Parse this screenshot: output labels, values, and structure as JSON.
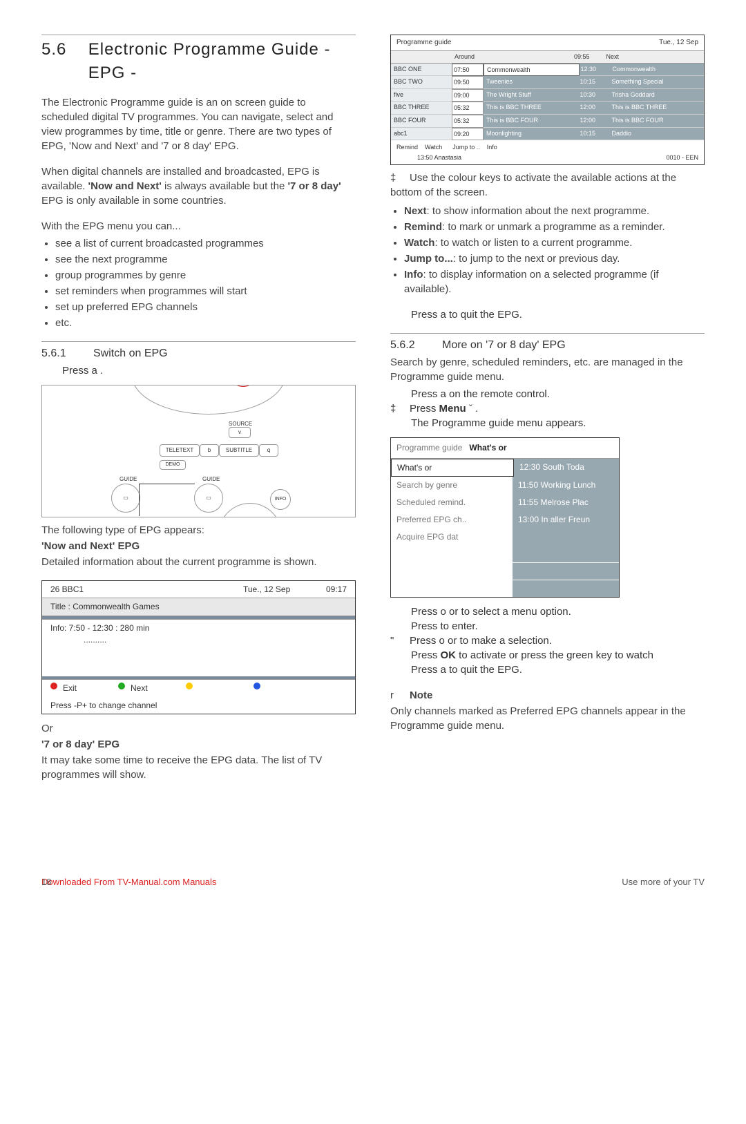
{
  "section": {
    "number": "5.6",
    "title": "Electronic Programme Guide - EPG -"
  },
  "intro": {
    "p1": "The Electronic Programme guide is an on screen guide to scheduled digital TV programmes. You can navigate, select and view programmes by time, title or genre. There are two types of EPG, 'Now and Next' and '7 or 8 day' EPG.",
    "p2a": "When digital channels are installed and broadcasted, EPG is available. ",
    "p2b": "'Now and Next'",
    "p2c": " is always available but the ",
    "p2d": "'7 or 8 day'",
    "p2e": " EPG is only available in some countries.",
    "p3": "With the EPG menu you can...",
    "bullets": [
      "see a list of current broadcasted programmes",
      "see the next programme",
      "group programmes by genre",
      "set reminders when programmes will start",
      "set up preferred EPG channels",
      "etc."
    ]
  },
  "s561": {
    "num": "5.6.1",
    "title": "Switch on EPG",
    "step1": "Press a   .",
    "after_remote": "The following type of EPG appears:",
    "now_next_hdr": "'Now and Next' EPG",
    "now_next_txt": "Detailed information about the current programme is shown.",
    "or": "Or",
    "seven_hdr": "'7 or 8 day' EPG",
    "seven_txt": "It may take some time to receive the EPG data. The list of TV programmes will show."
  },
  "remote": {
    "source": "SOURCE",
    "v": "v",
    "teletext": "TELETEXT",
    "b": "b",
    "subtitle": "SUBTITLE",
    "q": "q",
    "demo": "DEMO",
    "guide": "GUIDE",
    "info": "INFO"
  },
  "nownext": {
    "ch": "26   BBC1",
    "date": "Tue., 12 Sep",
    "time": "09:17",
    "title": "Title : Commonwealth Games",
    "info": "Info: 7:50 - 12:30 : 280 min",
    "dots": "..........",
    "exit": "Exit",
    "next": "Next",
    "press": "Press -P+ to change channel"
  },
  "grid": {
    "title": "Programme guide",
    "date": "Tue., 12 Sep",
    "around": "Around",
    "aroundTime": "09:55",
    "next": "Next",
    "rows": [
      {
        "ch": "BBC ONE",
        "t1": "07:50",
        "p1": "Commonwealth",
        "t2": "12:30",
        "p2": "Commonwealth"
      },
      {
        "ch": "BBC TWO",
        "t1": "09:50",
        "p1": "Tweenies",
        "t2": "10:15",
        "p2": "Something Special"
      },
      {
        "ch": "five",
        "t1": "09:00",
        "p1": "The Wright Stuff",
        "t2": "10:30",
        "p2": "Trisha Goddard"
      },
      {
        "ch": "BBC THREE",
        "t1": "05:32",
        "p1": "This is BBC THREE",
        "t2": "12:00",
        "p2": "This is BBC THREE"
      },
      {
        "ch": "BBC FOUR",
        "t1": "05:32",
        "p1": "This is BBC FOUR",
        "t2": "12:00",
        "p2": "This is BBC FOUR"
      },
      {
        "ch": "abc1",
        "t1": "09:20",
        "p1": "Moonlighting",
        "t2": "10:15",
        "p2": "Daddio"
      }
    ],
    "legend": {
      "remind": "Remind",
      "watch": "Watch",
      "jump": "Jump to ..",
      "info": "Info",
      "time": "13:50   Anastasia",
      "code": "0010 - EEN"
    }
  },
  "right": {
    "fi_text": "Use the colour keys to activate the available actions at the bottom of the screen.",
    "bullets": [
      {
        "b": "Next",
        "t": ": to show information about the next programme."
      },
      {
        "b": "Remind",
        "t": ": to mark or unmark a programme as a reminder."
      },
      {
        "b": "Watch",
        "t": ": to watch or listen to a current programme."
      },
      {
        "b": "Jump to...",
        "t": ": to jump to the next or previous day."
      },
      {
        "b": "Info",
        "t": ": to display information on a selected programme (if available)."
      }
    ],
    "quit": "Press a    to quit the EPG."
  },
  "s562": {
    "num": "5.6.2",
    "title": "More on '7 or 8 day' EPG",
    "p1": "Search by genre, scheduled reminders, etc. are managed in the Programme guide menu.",
    "step1": "Press a    on the remote control.",
    "step2a": "Press ",
    "step2b": "Menu",
    "step2c": " ˇ   .",
    "step2d": "The Programme guide menu appears."
  },
  "menu": {
    "hdr1": "Programme guide",
    "hdr2": "What's or",
    "rows": [
      {
        "l": "What's or",
        "r": "12:30 South Toda"
      },
      {
        "l": "Search by genre",
        "r": "11:50 Working Lunch"
      },
      {
        "l": "Scheduled remind.",
        "r": "11:55 Melrose Plac"
      },
      {
        "l": "Preferred EPG ch..",
        "r": "13:00 In aller Freun"
      },
      {
        "l": "Acquire EPG dat",
        "r": ""
      }
    ]
  },
  "after_menu": {
    "l1": "Press o  or      to select a menu option.",
    "l2": "Press      to enter.",
    "l3": "Press o  or      to make a selection.",
    "l4a": "Press ",
    "l4b": "OK",
    "l4c": " to activate or press the green key to watch",
    "l5": "Press a    to quit the EPG."
  },
  "note": {
    "hdr": "Note",
    "txt": "Only channels marked as Preferred EPG channels appear in the Programme guide menu."
  },
  "footer": {
    "dl": "Downloaded From TV-Manual.com Manuals",
    "pg": "Use more of your TV",
    "num": "18"
  }
}
